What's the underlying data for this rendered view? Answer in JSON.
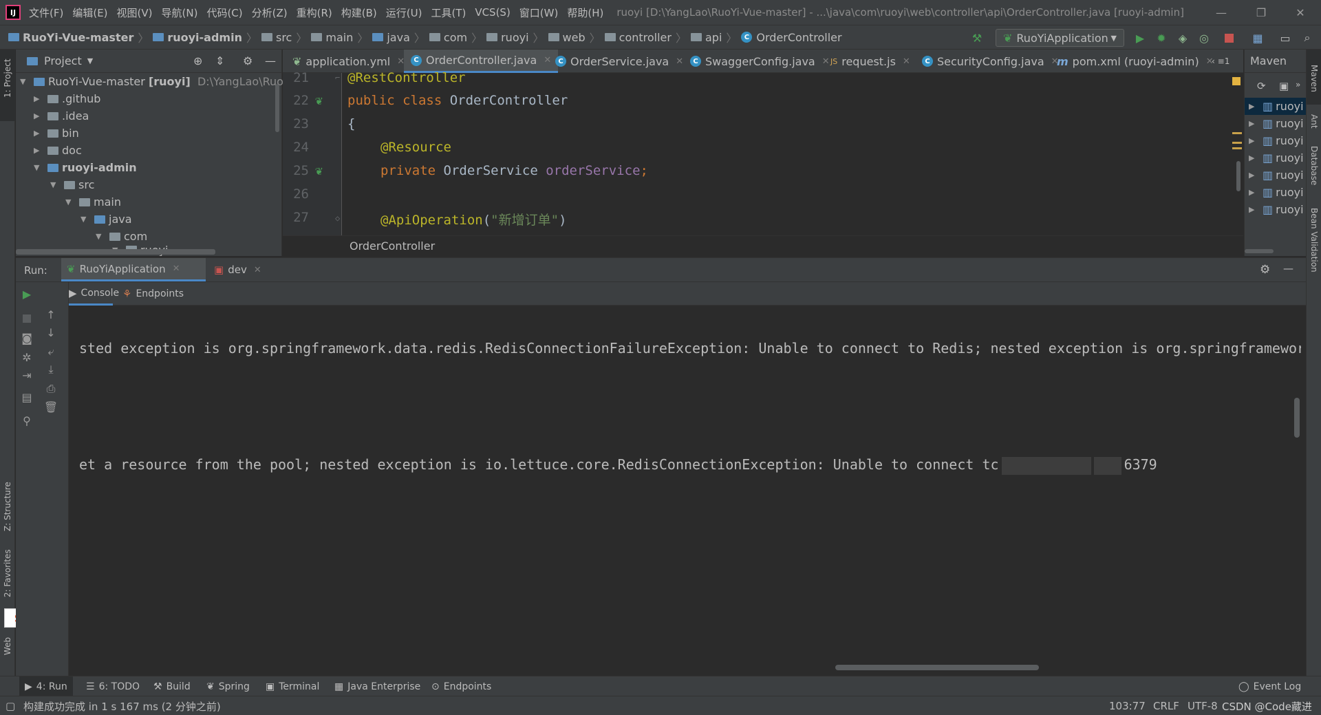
{
  "menubar": {
    "logo": "IJ",
    "items": [
      "文件(F)",
      "编辑(E)",
      "视图(V)",
      "导航(N)",
      "代码(C)",
      "分析(Z)",
      "重构(R)",
      "构建(B)",
      "运行(U)",
      "工具(T)",
      "VCS(S)",
      "窗口(W)",
      "帮助(H)"
    ],
    "title": "ruoyi [D:\\YangLao\\RuoYi-Vue-master] - ...\\java\\com\\ruoyi\\web\\controller\\api\\OrderController.java [ruoyi-admin]"
  },
  "navbar": {
    "crumbs": [
      "RuoYi-Vue-master",
      "ruoyi-admin",
      "src",
      "main",
      "java",
      "com",
      "ruoyi",
      "web",
      "controller",
      "api",
      "OrderController"
    ],
    "run_config": "RuoYiApplication"
  },
  "project": {
    "title": "Project",
    "tree": [
      {
        "label": "RuoYi-Vue-master",
        "suffix": "[ruoyi]",
        "path": "D:\\YangLao\\RuoYi-"
      },
      {
        "label": ".github"
      },
      {
        "label": ".idea"
      },
      {
        "label": "bin"
      },
      {
        "label": "doc"
      },
      {
        "label": "ruoyi-admin"
      },
      {
        "label": "src"
      },
      {
        "label": "main"
      },
      {
        "label": "java"
      },
      {
        "label": "com"
      },
      {
        "label": "ruoyi"
      }
    ]
  },
  "tabs": [
    "application.yml",
    "OrderController.java",
    "OrderService.java",
    "SwaggerConfig.java",
    "request.js",
    "SecurityConfig.java",
    "pom.xml (ruoyi-admin)"
  ],
  "tabs_overflow": "≡1",
  "editor": {
    "line_numbers": [
      "21",
      "22",
      "23",
      "24",
      "25",
      "26",
      "27"
    ],
    "lines": [
      {
        "ann": "@RestController"
      },
      {
        "kw": "public class ",
        "plain": "OrderController"
      },
      {
        "plain": "{"
      },
      {
        "ann": "@Resource"
      },
      {
        "kw": "private ",
        "plain": "OrderService ",
        "fld": "orderService",
        "end": ";"
      },
      {},
      {
        "ann": "@ApiOperation",
        "open": "(",
        "str": "\"新增订单\"",
        "close": ")"
      }
    ],
    "breadcrumb": "OrderController"
  },
  "maven": {
    "title": "Maven",
    "items": [
      "ruoyi",
      "ruoyi",
      "ruoyi",
      "ruoyi",
      "ruoyi",
      "ruoyi",
      "ruoyi"
    ]
  },
  "run": {
    "label": "Run:",
    "tabs": [
      "RuoYiApplication",
      "dev"
    ],
    "subtabs": [
      "Console",
      "Endpoints"
    ],
    "console_lines": [
      "sted exception is org.springframework.data.redis.RedisConnectionFailureException: Unable to connect to Redis; nested exception is org.springframework",
      "et a resource from the pool; nested exception is io.lettuce.core.RedisConnectionException: Unable to connect tc"
    ],
    "port": "6379"
  },
  "side_labels": {
    "left": [
      "1: Project",
      "Z: Structure",
      "2: Favorites",
      "Web"
    ],
    "right": [
      "Maven",
      "Ant",
      "Database",
      "Bean Validation"
    ]
  },
  "tool_tabs": [
    "4: Run",
    "6: TODO",
    "Build",
    "Spring",
    "Terminal",
    "Java Enterprise",
    "Endpoints"
  ],
  "event_log": "Event Log",
  "status": {
    "message": "构建成功完成 in 1 s 167 ms (2 分钟之前)",
    "position": "103:77",
    "line_sep": "CRLF",
    "encoding": "UTF-8",
    "watermark": "CSDN @Code藏进"
  },
  "colors": {
    "accent": "#4a88c7",
    "keyword": "#cc7832",
    "annotation": "#bbb529",
    "field": "#9876aa",
    "string": "#6a8759",
    "run_green": "#499c54",
    "stop_red": "#c75450"
  }
}
